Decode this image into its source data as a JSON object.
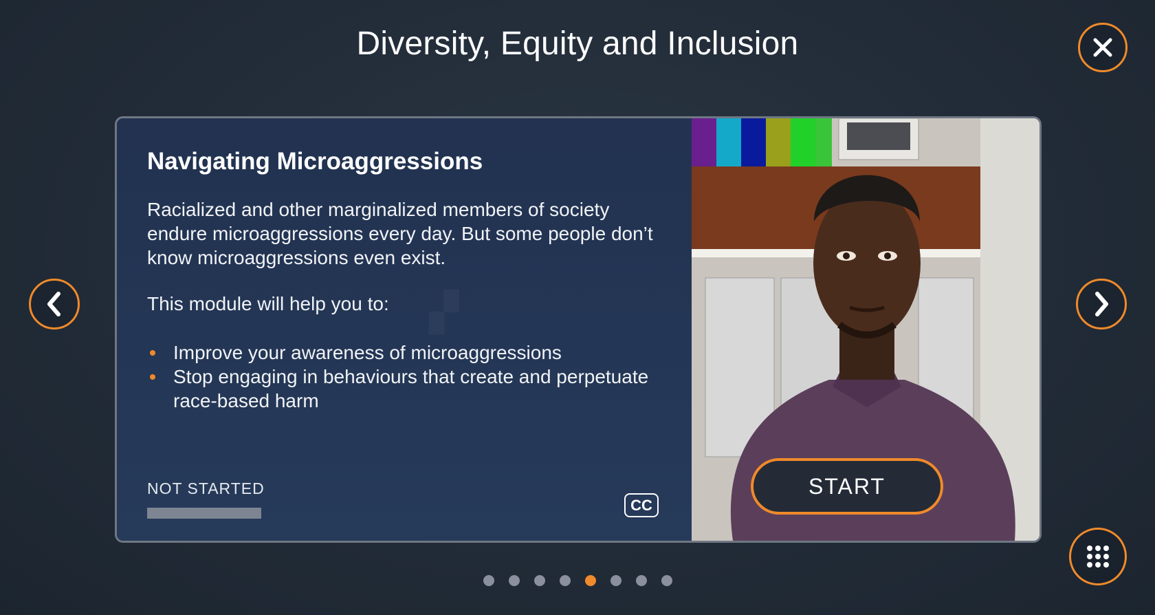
{
  "header": {
    "title": "Diversity, Equity and Inclusion"
  },
  "icons": {
    "close": "close-icon",
    "prev": "chevron-left-icon",
    "next": "chevron-right-icon",
    "menu": "grid-menu-icon",
    "cc": "closed-captions-icon"
  },
  "card": {
    "title": "Navigating Microaggressions",
    "description": "Racialized and other marginalized members of society endure microaggressions every day. But some people don’t know microaggressions even exist.",
    "help_intro": "This module will help you to:",
    "bullets": [
      "Improve your awareness of microaggressions",
      "Stop engaging in behaviours that create and perpetuate race-based harm"
    ],
    "status": "NOT STARTED",
    "progress": 0,
    "cc_label": "CC",
    "start_label": "START"
  },
  "pagination": {
    "total": 8,
    "active_index": 4
  },
  "colors": {
    "accent": "#f08a2a",
    "card_bg": "#233350",
    "page_bg": "#222c38"
  }
}
